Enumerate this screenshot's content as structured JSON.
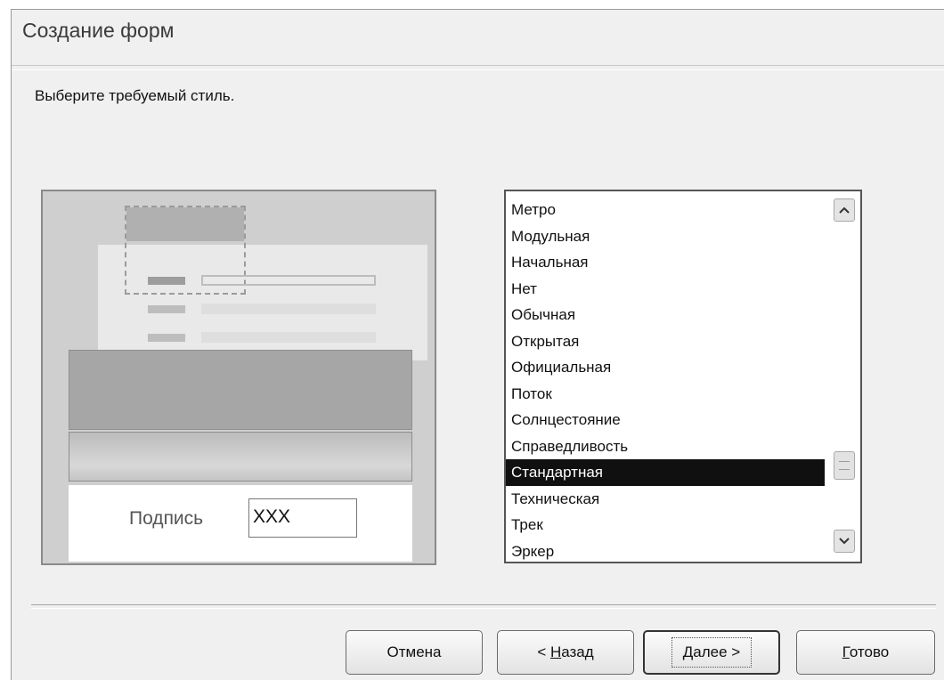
{
  "window": {
    "title": "Создание форм"
  },
  "instruction": "Выберите требуемый стиль.",
  "preview": {
    "caption": "Подпись",
    "field_value": "XXX"
  },
  "styles": {
    "items": [
      "Метро",
      "Модульная",
      "Начальная",
      "Нет",
      "Обычная",
      "Открытая",
      "Официальная",
      "Поток",
      "Солнцестояние",
      "Справедливость",
      "Стандартная",
      "Техническая",
      "Трек",
      "Эркер"
    ],
    "selected": "Стандартная"
  },
  "icons": {
    "scroll_up": "chevron-up-icon",
    "scroll_down": "chevron-down-icon"
  },
  "buttons": {
    "cancel": "Отмена",
    "back_prefix": "< ",
    "back_hotkey": "Н",
    "back_rest": "азад",
    "next_hotkey": "Д",
    "next_rest": "алее >",
    "finish_hotkey": "Г",
    "finish_rest": "отово"
  }
}
